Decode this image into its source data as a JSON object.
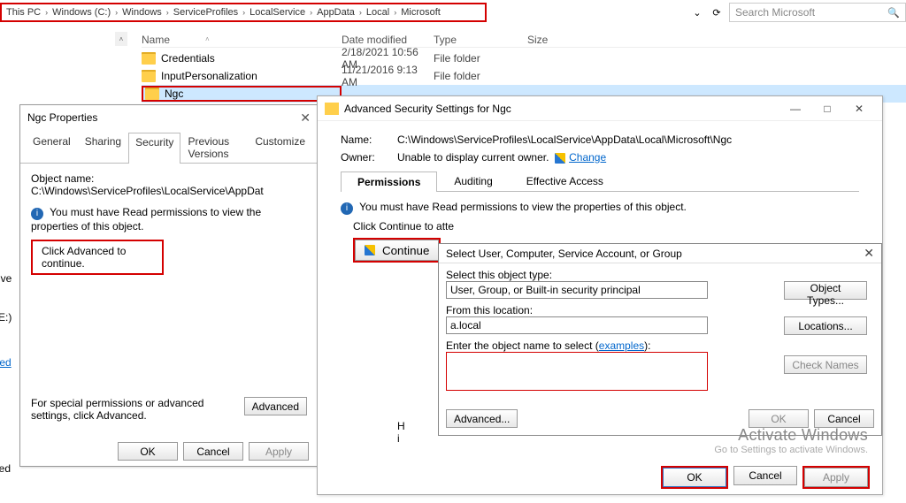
{
  "breadcrumb": [
    "This PC",
    "Windows (C:)",
    "Windows",
    "ServiceProfiles",
    "LocalService",
    "AppData",
    "Local",
    "Microsoft"
  ],
  "search": {
    "placeholder": "Search Microsoft"
  },
  "columns": {
    "name": "Name",
    "date": "Date modified",
    "type": "Type",
    "size": "Size"
  },
  "rows": [
    {
      "name": "Credentials",
      "date": "2/18/2021 10:56 AM",
      "type": "File folder"
    },
    {
      "name": "InputPersonalization",
      "date": "11/21/2016 9:13 AM",
      "type": "File folder"
    },
    {
      "name": "Ngc",
      "date": "",
      "type": ""
    }
  ],
  "leftcut": {
    "rive": "rive",
    "e": "E:)",
    "ted": "ted",
    "ded": "ded"
  },
  "propwin": {
    "title": "Ngc Properties",
    "tabs": [
      "General",
      "Sharing",
      "Security",
      "Previous Versions",
      "Customize"
    ],
    "active_tab": "Security",
    "object_label": "Object name:",
    "object": "C:\\Windows\\ServiceProfiles\\LocalService\\AppDat",
    "permnote": "You must have Read permissions to view the properties of this object.",
    "click_adv": "Click Advanced to continue.",
    "adv_text": "For special permissions or advanced settings, click Advanced.",
    "advanced": "Advanced",
    "ok": "OK",
    "cancel": "Cancel",
    "apply": "Apply"
  },
  "advwin": {
    "title": "Advanced Security Settings for Ngc",
    "name_label": "Name:",
    "name": "C:\\Windows\\ServiceProfiles\\LocalService\\AppData\\Local\\Microsoft\\Ngc",
    "owner_label": "Owner:",
    "owner": "Unable to display current owner.",
    "change": "Change",
    "tabs": [
      "Permissions",
      "Auditing",
      "Effective Access"
    ],
    "readperm": "You must have Read permissions to view the properties of this object.",
    "cont_line": "Click Continue to atte",
    "continue": "Continue",
    "h": "H",
    "i": "i",
    "ok": "OK",
    "cancel": "Cancel",
    "apply": "Apply"
  },
  "seluser": {
    "title": "Select User, Computer, Service Account, or Group",
    "objtype_label": "Select this object type:",
    "objtype": "User, Group, or Built-in security principal",
    "objtypes_btn": "Object Types...",
    "from_label": "From this location:",
    "from": "a.local",
    "locations_btn": "Locations...",
    "enter_label": "Enter the object name to select",
    "examples": "examples",
    "check": "Check Names",
    "advanced": "Advanced...",
    "ok": "OK",
    "cancel": "Cancel"
  },
  "watermark": {
    "big": "Activate Windows",
    "sm": "Go to Settings to activate Windows."
  }
}
